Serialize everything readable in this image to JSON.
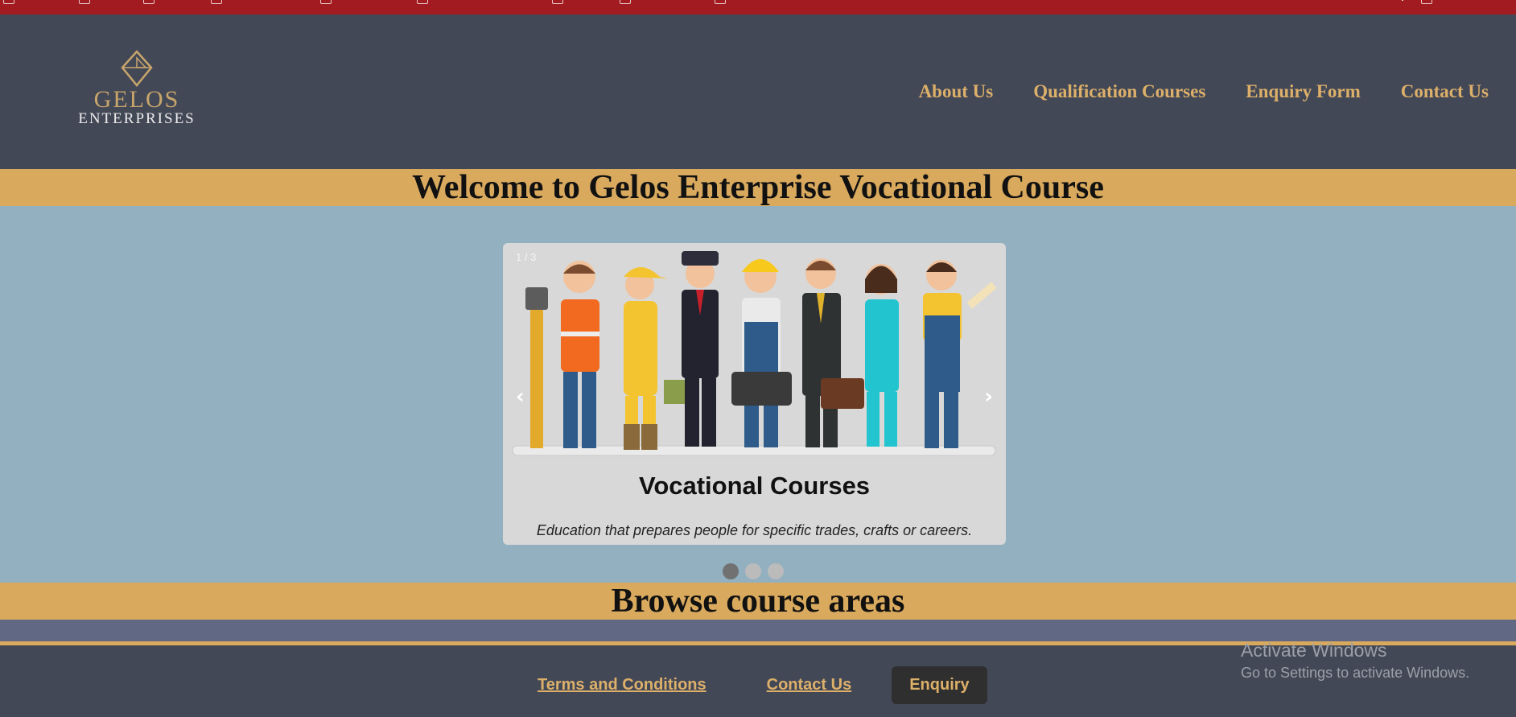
{
  "header": {
    "logo": {
      "brand": "GELOS",
      "sub": "ENTERPRISES"
    },
    "nav": [
      "About Us",
      "Qualification Courses",
      "Enquiry Form",
      "Contact Us"
    ]
  },
  "welcome_title": "Welcome to Gelos Enterprise Vocational Course",
  "carousel": {
    "counter": "1 / 3",
    "prev_icon": "‹",
    "next_icon": "›",
    "title": "Vocational Courses",
    "text": "Education that prepares people for specific trades, crafts or careers.",
    "slides_total": 3,
    "active_slide": 1
  },
  "browse_title": "Browse course areas",
  "footer": {
    "terms": "Terms and Conditions",
    "contact": "Contact Us",
    "enquiry": "Enquiry"
  },
  "watermark": {
    "title": "Activate Windows",
    "subtitle": "Go to Settings to activate Windows."
  },
  "colors": {
    "topbar": "#a21b20",
    "header": "#434856",
    "accent_gold": "#d9a95e",
    "body_bg": "#93b0c0"
  }
}
